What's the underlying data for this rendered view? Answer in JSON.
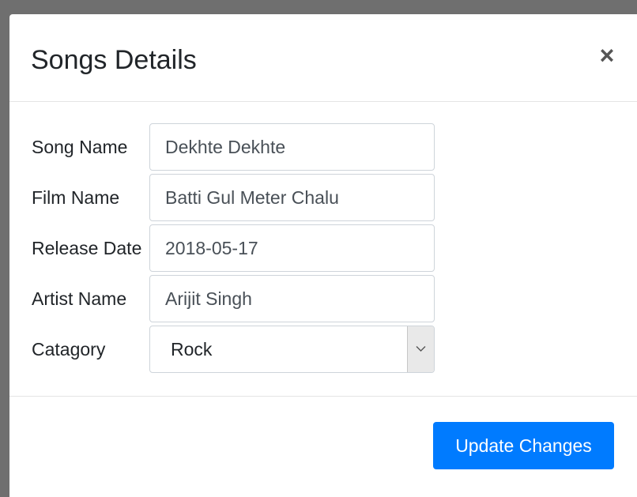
{
  "modal": {
    "title": "Songs Details",
    "close_label": "×"
  },
  "form": {
    "fields": [
      {
        "label": "Song Name",
        "value": "Dekhte Dekhte"
      },
      {
        "label": "Film Name",
        "value": "Batti Gul Meter Chalu"
      },
      {
        "label": "Release Date",
        "value": "2018-05-17"
      },
      {
        "label": "Artist Name",
        "value": "Arijit Singh"
      }
    ],
    "category": {
      "label": "Catagory",
      "selected": "Rock",
      "icon": "chevron-down-icon"
    }
  },
  "footer": {
    "submit_label": "Update Changes",
    "submit_color": "#007bff"
  }
}
